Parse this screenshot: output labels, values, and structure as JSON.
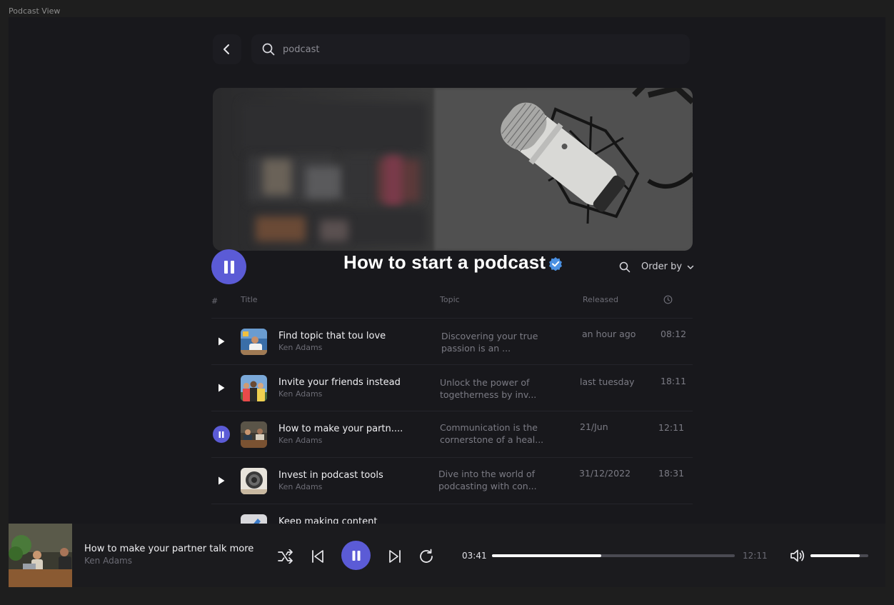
{
  "frame_label": "Podcast View",
  "search": {
    "value": "podcast"
  },
  "podcast": {
    "title": "How to start a podcast"
  },
  "controls": {
    "order_by": "Order by"
  },
  "table": {
    "headers": {
      "num": "#",
      "title": "Title",
      "topic": "Topic",
      "released": "Released"
    },
    "rows": [
      {
        "title": "Find topic that tou love",
        "author": "Ken Adams",
        "topic": "Discovering your true passion is an ...",
        "released": "an hour ago",
        "duration": "08:12",
        "state": "play"
      },
      {
        "title": "Invite your friends instead",
        "author": "Ken Adams",
        "topic": "Unlock the power of togetherness by inv...",
        "released": "last tuesday",
        "duration": "18:11",
        "state": "play"
      },
      {
        "title": "How to make your partn....",
        "author": "Ken Adams",
        "topic": "Communication is the cornerstone of a heal...",
        "released": "21/Jun",
        "duration": "12:11",
        "state": "pause"
      },
      {
        "title": "Invest in podcast tools",
        "author": "Ken Adams",
        "topic": "Dive into the world of podcasting with con...",
        "released": "31/12/2022",
        "duration": "18:31",
        "state": "play"
      },
      {
        "title": "Keep making content",
        "author": "",
        "topic": "",
        "released": "",
        "duration": "",
        "state": "play"
      }
    ]
  },
  "player": {
    "title": "How to make your partner talk more",
    "author": "Ken Adams",
    "current_time": "03:41",
    "total_time": "12:11",
    "progress": 0.45,
    "volume": 0.85
  },
  "colors": {
    "accent": "#5b5bd6",
    "background": "#18181c",
    "verified": "#4a90e2"
  }
}
